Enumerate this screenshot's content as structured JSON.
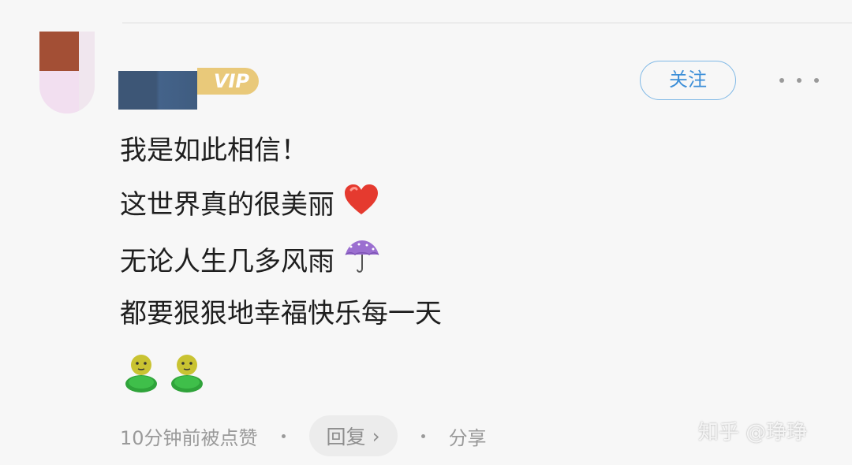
{
  "comment": {
    "lines": [
      "我是如此相信！",
      "这世界真的很美丽",
      "无论人生几多风雨",
      "都要狠狠地幸福快乐每一天"
    ],
    "line_emojis": [
      null,
      "red-heart",
      "umbrella-with-rain",
      null
    ],
    "reaction_emojis": [
      "green-bean-figure",
      "green-bean-figure"
    ]
  },
  "header": {
    "vip_badge": "VIP",
    "follow_label": "关注"
  },
  "meta": {
    "time_text": "10分钟前被点赞",
    "reply_label": "回复",
    "reply_chevron": "›",
    "share_label": "分享"
  },
  "watermark": {
    "text": "知乎 @琤琤"
  },
  "colors": {
    "follow": "#3d8fd8",
    "vip_gold": "#e9c97a",
    "meta_text": "#9a9a9a"
  }
}
